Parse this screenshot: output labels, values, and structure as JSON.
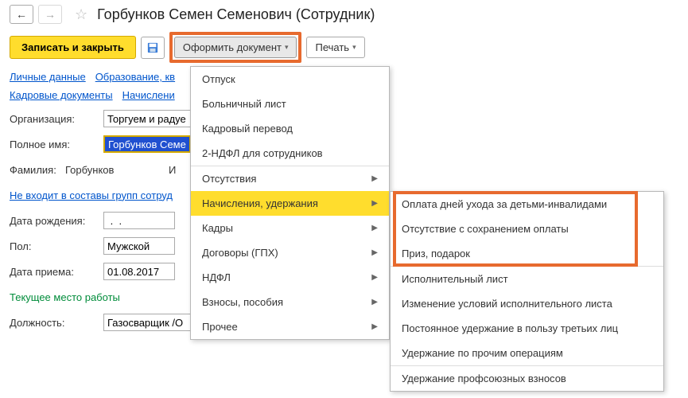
{
  "header": {
    "title": "Горбунков Семен Семенович (Сотрудник)"
  },
  "toolbar": {
    "save_close": "Записать и закрыть",
    "doc_button": "Оформить документ",
    "print": "Печать"
  },
  "tabs": {
    "personal": "Личные данные",
    "education": "Образование, кв",
    "hr_docs": "Кадровые документы",
    "accruals": "Начислени"
  },
  "form": {
    "org_label": "Организация:",
    "org_value": "Торгуем и радуе",
    "fullname_label": "Полное имя:",
    "fullname_value": "Горбунков Семен",
    "surname_label": "Фамилия:",
    "surname_value": "Горбунков",
    "name_label": "И",
    "groups_link": "Не входит в составы групп сотруд",
    "dob_label": "Дата рождения:",
    "dob_value": " .  .    ",
    "sex_label": "Пол:",
    "sex_value": "Мужской",
    "hire_label": "Дата приема:",
    "hire_value": "01.08.2017",
    "current_place": "Текущее место работы",
    "position_label": "Должность:",
    "position_value": "Газосварщик /О"
  },
  "menu1": {
    "items": [
      {
        "label": "Отпуск",
        "sub": false
      },
      {
        "label": "Больничный лист",
        "sub": false
      },
      {
        "label": "Кадровый перевод",
        "sub": false
      },
      {
        "label": "2-НДФЛ для сотрудников",
        "sub": false
      },
      {
        "label": "Отсутствия",
        "sub": true,
        "sep_before": true
      },
      {
        "label": "Начисления, удержания",
        "sub": true,
        "hl": true
      },
      {
        "label": "Кадры",
        "sub": true
      },
      {
        "label": "Договоры (ГПХ)",
        "sub": true
      },
      {
        "label": "НДФЛ",
        "sub": true
      },
      {
        "label": "Взносы, пособия",
        "sub": true
      },
      {
        "label": "Прочее",
        "sub": true
      }
    ]
  },
  "menu2": {
    "items": [
      {
        "label": "Оплата дней ухода за детьми-инвалидами"
      },
      {
        "label": "Отсутствие с сохранением оплаты"
      },
      {
        "label": "Приз, подарок"
      },
      {
        "label": "Исполнительный лист",
        "sep_before": true
      },
      {
        "label": "Изменение условий исполнительного листа"
      },
      {
        "label": "Постоянное удержание в пользу третьих лиц"
      },
      {
        "label": "Удержание по прочим операциям"
      },
      {
        "label": "Удержание профсоюзных взносов",
        "sep_before": true
      }
    ]
  }
}
